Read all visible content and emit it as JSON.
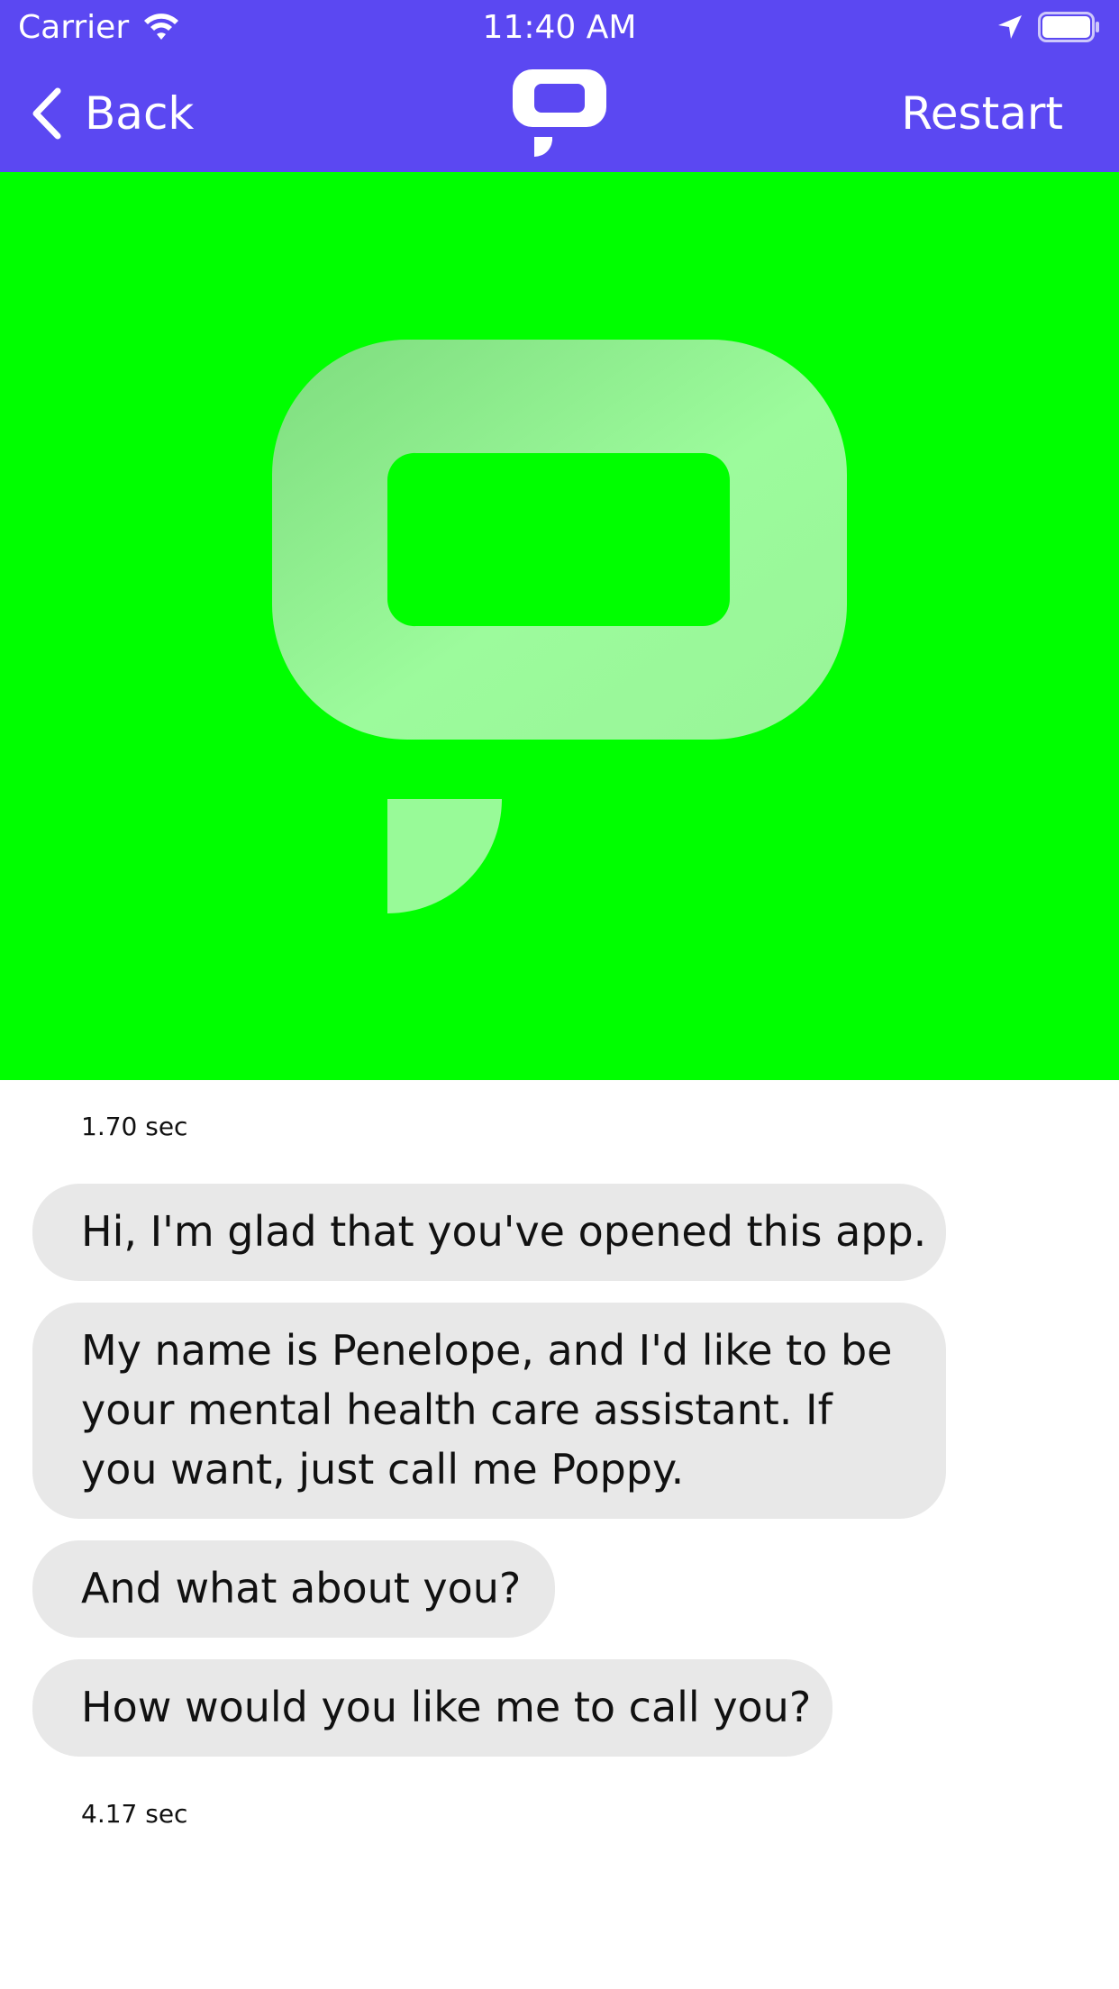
{
  "status_bar": {
    "carrier": "Carrier",
    "time": "11:40 AM",
    "icons": [
      "wifi-icon",
      "location-arrow-icon",
      "battery-icon"
    ]
  },
  "nav": {
    "back_label": "Back",
    "restart_label": "Restart",
    "logo_icon": "speech-bubble-logo-icon"
  },
  "hero": {
    "logo_icon": "speech-bubble-logo-icon"
  },
  "chat": {
    "timestamps": [
      "1.70 sec",
      "4.17 sec"
    ],
    "messages": [
      "Hi, I'm glad that you've opened this app.",
      "My name is Penelope, and I'd like to be your mental health care assistant. If you want, just call me Poppy.",
      "And what about you?",
      "How would you like me to call you?"
    ]
  },
  "colors": {
    "nav_background": "#5b48f2",
    "hero_background": "#00ff00",
    "bubble_background": "#e8e8e8",
    "text": "#111111"
  }
}
